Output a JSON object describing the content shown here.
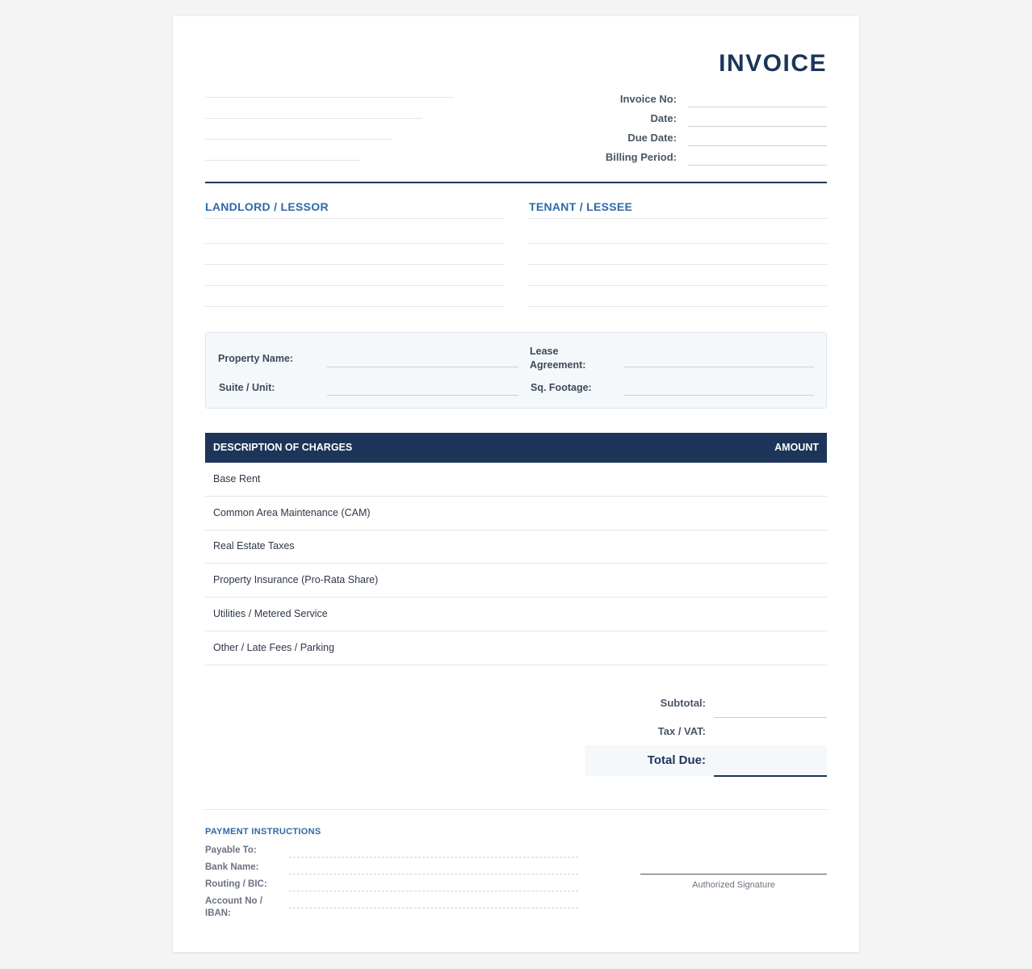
{
  "invoice": {
    "title": "INVOICE",
    "meta_labels": [
      "Invoice No:",
      "Date:",
      "Due Date:",
      "Billing Period:"
    ]
  },
  "parties": {
    "landlord_heading": "LANDLORD / LESSOR",
    "tenant_heading": "TENANT / LESSEE"
  },
  "property": {
    "property_name_label": "Property Name:",
    "lease_agreement_label": "Lease Agreement:",
    "suite_label": "Suite / Unit:",
    "sqft_label": "Sq. Footage:"
  },
  "charges": {
    "col_description": "DESCRIPTION OF CHARGES",
    "col_amount": "AMOUNT",
    "rows": [
      "Base Rent",
      "Common Area Maintenance (CAM)",
      "Real Estate Taxes",
      "Property Insurance (Pro-Rata Share)",
      "Utilities / Metered Service",
      "Other / Late Fees / Parking"
    ]
  },
  "totals": {
    "subtotal_label": "Subtotal:",
    "tax_label": "Tax / VAT:",
    "total_due_label": "Total Due:"
  },
  "payment": {
    "heading": "PAYMENT INSTRUCTIONS",
    "payable_to_label": "Payable To:",
    "bank_name_label": "Bank Name:",
    "routing_label": "Routing / BIC:",
    "account_label": "Account No / IBAN:"
  },
  "signature": {
    "label": "Authorized Signature"
  },
  "colors": {
    "navy": "#1c3559",
    "accent_blue": "#2e6aa8",
    "panel_bg": "#f5f8fb"
  }
}
